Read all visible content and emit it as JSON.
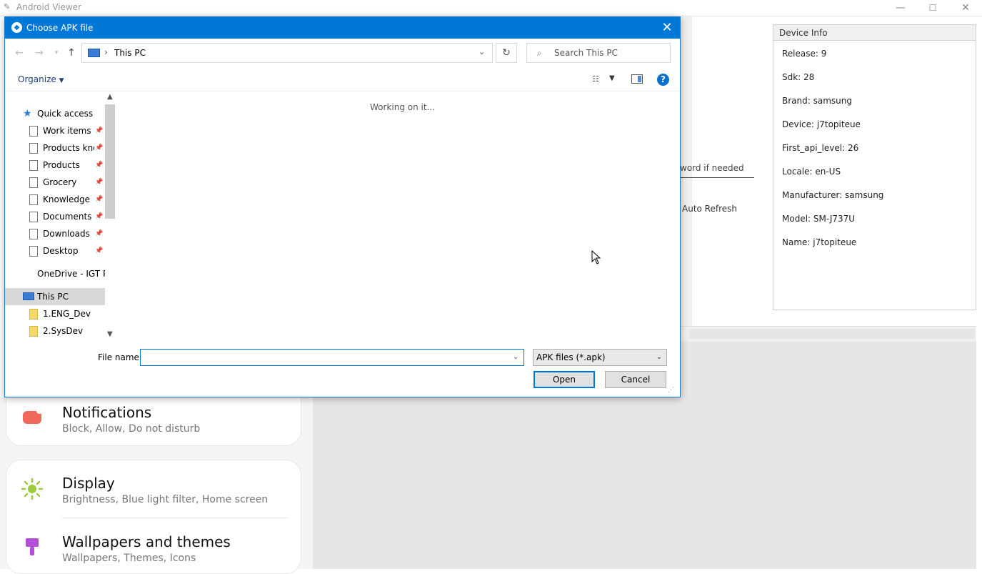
{
  "app": {
    "title": "Android Viewer",
    "controls": {
      "minimize": "—",
      "maximize": "☐",
      "close": "✕"
    }
  },
  "background": {
    "password_hint": "word if needed",
    "auto_refresh": "Auto Refresh"
  },
  "device_info": {
    "header": "Device Info",
    "items": [
      "Release: 9",
      "Sdk: 28",
      "Brand: samsung",
      "Device: j7topiteue",
      "First_api_level: 26",
      "Locale: en-US",
      "Manufacturer: samsung",
      "Model: SM-J737U",
      "Name: j7topiteue"
    ]
  },
  "phone_settings": [
    {
      "title": "Notifications",
      "subtitle": "Block, Allow, Do not disturb",
      "icon": "notifications-icon",
      "color": "#f0685b"
    },
    {
      "title": "Display",
      "subtitle": "Brightness, Blue light filter, Home screen",
      "icon": "display-sun-icon",
      "color": "#9ccc3a"
    },
    {
      "title": "Wallpapers and themes",
      "subtitle": "Wallpapers, Themes, Icons",
      "icon": "paintbrush-icon",
      "color": "#b14fd6"
    }
  ],
  "dialog": {
    "title": "Choose APK file",
    "address": "This PC",
    "search_placeholder": "Search This PC",
    "organize": "Organize",
    "status": "Working on it...",
    "nav": {
      "quick_access": "Quick access",
      "pinned": [
        "Work items",
        "Products kno",
        "Products",
        "Grocery",
        "Knowledge",
        "Documents",
        "Downloads",
        "Desktop"
      ],
      "onedrive": "OneDrive - IGT PL",
      "this_pc": "This PC",
      "folders": [
        "1.ENG_Dev",
        "2.SysDev"
      ]
    },
    "file_name_label": "File name:",
    "file_name_value": "",
    "file_type": "APK files (*.apk)",
    "open_label": "Open",
    "cancel_label": "Cancel",
    "accent": "#0078d7"
  }
}
